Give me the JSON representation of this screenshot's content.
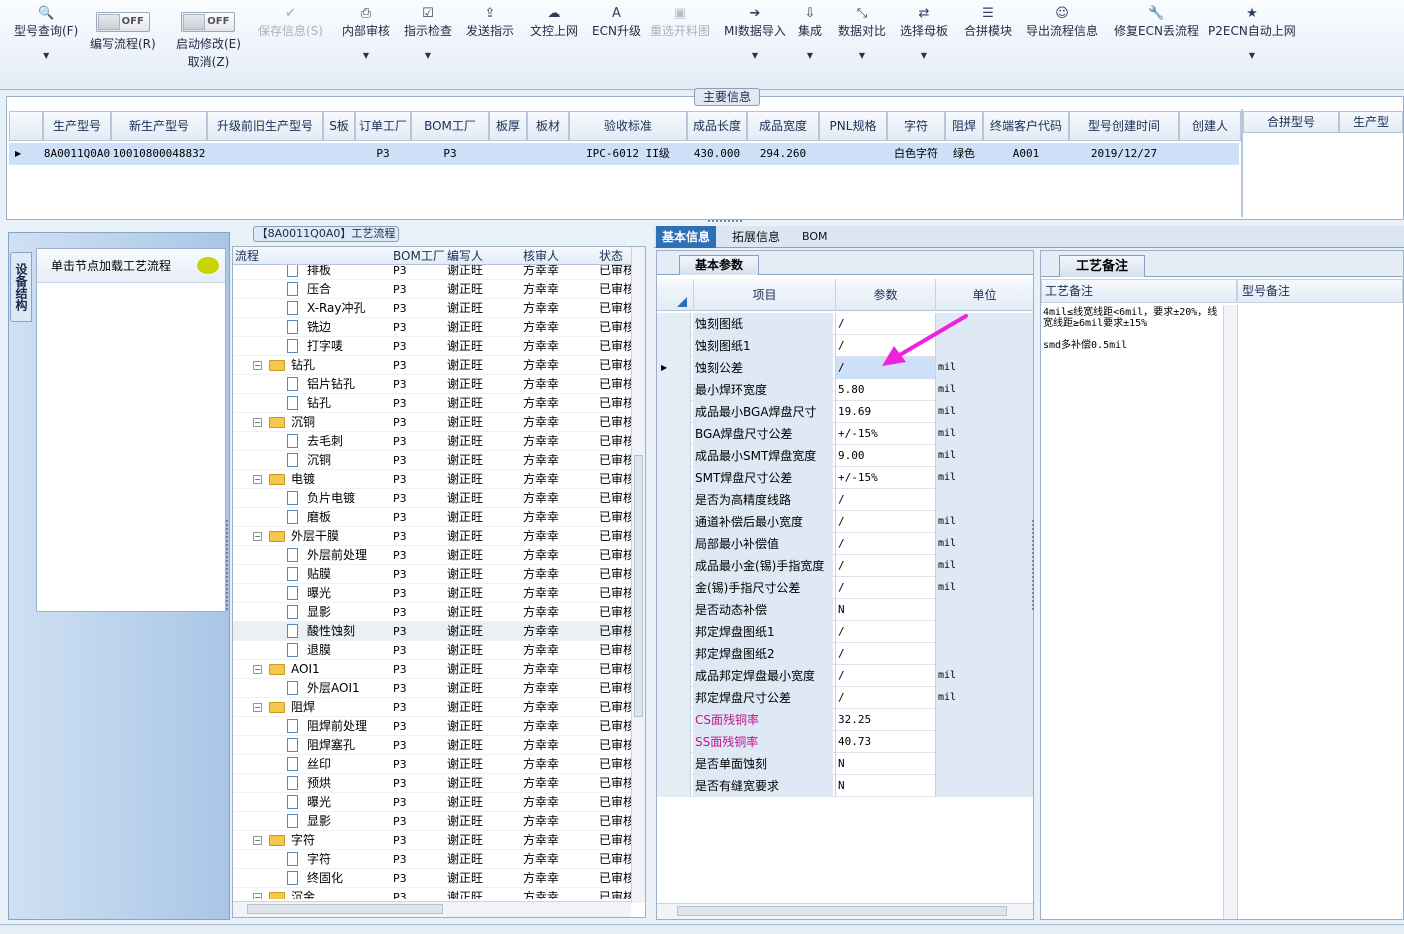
{
  "toolbar": {
    "items": [
      {
        "icon": "search-icon",
        "label": "型号查询(F)",
        "dropdown": true,
        "enabled": true
      },
      {
        "toggle": "OFF",
        "label": "编写流程(R)",
        "enabled": true
      },
      {
        "toggle": "OFF",
        "label": "启动修改(E)",
        "label2": "取消(Z)",
        "enabled": true
      },
      {
        "icon": "check-icon",
        "label": "保存信息(S)",
        "enabled": false
      },
      {
        "icon": "printer-icon",
        "label": "内部审核",
        "dropdown": true,
        "enabled": true
      },
      {
        "icon": "checkbox-icon",
        "label": "指示检查",
        "dropdown": true,
        "enabled": true
      },
      {
        "icon": "upload-icon",
        "label": "发送指示",
        "enabled": true
      },
      {
        "icon": "cloud-upload-icon",
        "label": "文控上网",
        "enabled": true
      },
      {
        "icon": "font-a-icon",
        "label": "ECN升级",
        "enabled": true
      },
      {
        "icon": "image-icon",
        "label": "重选开料图",
        "enabled": false
      },
      {
        "icon": "import-icon",
        "label": "MI数据导入",
        "dropdown": true,
        "enabled": true
      },
      {
        "icon": "download-icon",
        "label": "集成",
        "dropdown": true,
        "enabled": true
      },
      {
        "icon": "compress-icon",
        "label": "数据对比",
        "dropdown": true,
        "enabled": true
      },
      {
        "icon": "shuffle-icon",
        "label": "选择母板",
        "dropdown": true,
        "enabled": true
      },
      {
        "icon": "list-icon",
        "label": "合拼模块",
        "enabled": true
      },
      {
        "icon": "smile-icon",
        "label": "导出流程信息",
        "enabled": true
      },
      {
        "icon": "wrench-icon",
        "label": "修复ECN丢流程",
        "enabled": true
      },
      {
        "icon": "star-icon",
        "label": "P2ECN自动上网",
        "dropdown": true,
        "enabled": true
      }
    ]
  },
  "main_info": {
    "title": "主要信息",
    "columns": [
      "生产型号",
      "新生产型号",
      "升级前旧生产型号",
      "S板",
      "订单工厂",
      "BOM工厂",
      "板厚",
      "板材",
      "验收标准",
      "成品长度",
      "成品宽度",
      "PNL规格",
      "字符",
      "阻焊",
      "终端客户代码",
      "型号创建时间",
      "创建人"
    ],
    "row": [
      "8A0011Q0A0",
      "10010800048832",
      "",
      "",
      "P3",
      "P3",
      "",
      "",
      "IPC-6012 II级",
      "430.000",
      "294.260",
      "",
      "白色字符",
      "绿色",
      "A001",
      "2019/12/27",
      ""
    ],
    "right_columns": [
      "合拼型号",
      "生产型"
    ]
  },
  "device_panel": {
    "vertical_tab": "设备结构",
    "header": "单击节点加载工艺流程"
  },
  "process": {
    "title": "【8A0011Q0A0】工艺流程",
    "columns": [
      "流程",
      "BOM工厂",
      "编写人",
      "核审人",
      "状态"
    ],
    "rows": [
      {
        "name": "排板",
        "level": 2,
        "type": "file",
        "f": "P3",
        "w": "谢正旺",
        "r": "方幸幸",
        "s": "已审核"
      },
      {
        "name": "压合",
        "level": 2,
        "type": "file",
        "f": "P3",
        "w": "谢正旺",
        "r": "方幸幸",
        "s": "已审核"
      },
      {
        "name": "X-Ray冲孔",
        "level": 2,
        "type": "file",
        "f": "P3",
        "w": "谢正旺",
        "r": "方幸幸",
        "s": "已审核"
      },
      {
        "name": "铣边",
        "level": 2,
        "type": "file",
        "f": "P3",
        "w": "谢正旺",
        "r": "方幸幸",
        "s": "已审核"
      },
      {
        "name": "打字唛",
        "level": 2,
        "type": "file",
        "f": "P3",
        "w": "谢正旺",
        "r": "方幸幸",
        "s": "已审核"
      },
      {
        "name": "钻孔",
        "level": 1,
        "type": "folder",
        "f": "P3",
        "w": "谢正旺",
        "r": "方幸幸",
        "s": "已审核"
      },
      {
        "name": "铝片钻孔",
        "level": 2,
        "type": "file",
        "f": "P3",
        "w": "谢正旺",
        "r": "方幸幸",
        "s": "已审核"
      },
      {
        "name": "钻孔",
        "level": 2,
        "type": "file",
        "f": "P3",
        "w": "谢正旺",
        "r": "方幸幸",
        "s": "已审核"
      },
      {
        "name": "沉铜",
        "level": 1,
        "type": "folder",
        "f": "P3",
        "w": "谢正旺",
        "r": "方幸幸",
        "s": "已审核"
      },
      {
        "name": "去毛刺",
        "level": 2,
        "type": "file",
        "f": "P3",
        "w": "谢正旺",
        "r": "方幸幸",
        "s": "已审核"
      },
      {
        "name": "沉铜",
        "level": 2,
        "type": "file",
        "f": "P3",
        "w": "谢正旺",
        "r": "方幸幸",
        "s": "已审核"
      },
      {
        "name": "电镀",
        "level": 1,
        "type": "folder",
        "f": "P3",
        "w": "谢正旺",
        "r": "方幸幸",
        "s": "已审核"
      },
      {
        "name": "负片电镀",
        "level": 2,
        "type": "file",
        "f": "P3",
        "w": "谢正旺",
        "r": "方幸幸",
        "s": "已审核"
      },
      {
        "name": "磨板",
        "level": 2,
        "type": "file",
        "f": "P3",
        "w": "谢正旺",
        "r": "方幸幸",
        "s": "已审核"
      },
      {
        "name": "外层干膜",
        "level": 1,
        "type": "folder",
        "f": "P3",
        "w": "谢正旺",
        "r": "方幸幸",
        "s": "已审核"
      },
      {
        "name": "外层前处理",
        "level": 2,
        "type": "file",
        "f": "P3",
        "w": "谢正旺",
        "r": "方幸幸",
        "s": "已审核"
      },
      {
        "name": "贴膜",
        "level": 2,
        "type": "file",
        "f": "P3",
        "w": "谢正旺",
        "r": "方幸幸",
        "s": "已审核"
      },
      {
        "name": "曝光",
        "level": 2,
        "type": "file",
        "f": "P3",
        "w": "谢正旺",
        "r": "方幸幸",
        "s": "已审核"
      },
      {
        "name": "显影",
        "level": 2,
        "type": "file",
        "f": "P3",
        "w": "谢正旺",
        "r": "方幸幸",
        "s": "已审核"
      },
      {
        "name": "酸性蚀刻",
        "level": 2,
        "type": "file",
        "f": "P3",
        "w": "谢正旺",
        "r": "方幸幸",
        "s": "已审核",
        "selected": true
      },
      {
        "name": "退膜",
        "level": 2,
        "type": "file",
        "f": "P3",
        "w": "谢正旺",
        "r": "方幸幸",
        "s": "已审核"
      },
      {
        "name": "AOI1",
        "level": 1,
        "type": "folder",
        "f": "P3",
        "w": "谢正旺",
        "r": "方幸幸",
        "s": "已审核"
      },
      {
        "name": "外层AOI1",
        "level": 2,
        "type": "file",
        "f": "P3",
        "w": "谢正旺",
        "r": "方幸幸",
        "s": "已审核"
      },
      {
        "name": "阻焊",
        "level": 1,
        "type": "folder",
        "f": "P3",
        "w": "谢正旺",
        "r": "方幸幸",
        "s": "已审核"
      },
      {
        "name": "阻焊前处理",
        "level": 2,
        "type": "file",
        "f": "P3",
        "w": "谢正旺",
        "r": "方幸幸",
        "s": "已审核"
      },
      {
        "name": "阻焊塞孔",
        "level": 2,
        "type": "file",
        "f": "P3",
        "w": "谢正旺",
        "r": "方幸幸",
        "s": "已审核"
      },
      {
        "name": "丝印",
        "level": 2,
        "type": "file",
        "f": "P3",
        "w": "谢正旺",
        "r": "方幸幸",
        "s": "已审核"
      },
      {
        "name": "预烘",
        "level": 2,
        "type": "file",
        "f": "P3",
        "w": "谢正旺",
        "r": "方幸幸",
        "s": "已审核"
      },
      {
        "name": "曝光",
        "level": 2,
        "type": "file",
        "f": "P3",
        "w": "谢正旺",
        "r": "方幸幸",
        "s": "已审核"
      },
      {
        "name": "显影",
        "level": 2,
        "type": "file",
        "f": "P3",
        "w": "谢正旺",
        "r": "方幸幸",
        "s": "已审核"
      },
      {
        "name": "字符",
        "level": 1,
        "type": "folder",
        "f": "P3",
        "w": "谢正旺",
        "r": "方幸幸",
        "s": "已审核"
      },
      {
        "name": "字符",
        "level": 2,
        "type": "file",
        "f": "P3",
        "w": "谢正旺",
        "r": "方幸幸",
        "s": "已审核"
      },
      {
        "name": "终固化",
        "level": 2,
        "type": "file",
        "f": "P3",
        "w": "谢正旺",
        "r": "方幸幸",
        "s": "已审核"
      },
      {
        "name": "沉金",
        "level": 1,
        "type": "folder",
        "f": "P3",
        "w": "谢正旺",
        "r": "方幸幸",
        "s": "已审核"
      }
    ]
  },
  "details": {
    "tabs": [
      "基本信息",
      "拓展信息",
      "BOM"
    ],
    "subtab": "基本参数",
    "columns": [
      "项目",
      "参数",
      "单位"
    ],
    "rows": [
      {
        "item": "蚀刻图纸",
        "value": "/",
        "unit": ""
      },
      {
        "item": "蚀刻图纸1",
        "value": "/",
        "unit": ""
      },
      {
        "item": "蚀刻公差",
        "value": "/",
        "unit": "mil",
        "current": true
      },
      {
        "item": "最小焊环宽度",
        "value": "5.80",
        "unit": "mil"
      },
      {
        "item": "成品最小BGA焊盘尺寸",
        "value": "19.69",
        "unit": "mil"
      },
      {
        "item": "BGA焊盘尺寸公差",
        "value": "+/-15%",
        "unit": "mil"
      },
      {
        "item": "成品最小SMT焊盘宽度",
        "value": "9.00",
        "unit": "mil"
      },
      {
        "item": "SMT焊盘尺寸公差",
        "value": "+/-15%",
        "unit": "mil"
      },
      {
        "item": "是否为高精度线路",
        "value": "/",
        "unit": ""
      },
      {
        "item": "通道补偿后最小宽度",
        "value": "/",
        "unit": "mil"
      },
      {
        "item": "局部最小补偿值",
        "value": "/",
        "unit": "mil"
      },
      {
        "item": "成品最小金(锡)手指宽度",
        "value": "/",
        "unit": "mil"
      },
      {
        "item": "金(锡)手指尺寸公差",
        "value": "/",
        "unit": "mil"
      },
      {
        "item": "是否动态补偿",
        "value": "N",
        "unit": ""
      },
      {
        "item": "邦定焊盘图纸1",
        "value": "/",
        "unit": ""
      },
      {
        "item": "邦定焊盘图纸2",
        "value": "/",
        "unit": ""
      },
      {
        "item": "成品邦定焊盘最小宽度",
        "value": "/",
        "unit": "mil"
      },
      {
        "item": "邦定焊盘尺寸公差",
        "value": "/",
        "unit": "mil"
      },
      {
        "item": "CS面残铜率",
        "value": "32.25",
        "unit": "",
        "pink": true
      },
      {
        "item": "SS面残铜率",
        "value": "40.73",
        "unit": "",
        "pink": true
      },
      {
        "item": "是否单面蚀刻",
        "value": "N",
        "unit": ""
      },
      {
        "item": "是否有缝宽要求",
        "value": "N",
        "unit": ""
      }
    ]
  },
  "remarks": {
    "tab": "工艺备注",
    "columns": [
      "工艺备注",
      "型号备注"
    ],
    "text": "4mil≤线宽线距<6mil，要求±20%，线宽线距≥6mil要求±15%\n\nsmd多补偿0.5mil"
  },
  "colors": {
    "accent": "#2f6fb6",
    "selected_row": "#cde0f7",
    "pink_text": "#c0168c",
    "arrow": "#ee22dd"
  }
}
